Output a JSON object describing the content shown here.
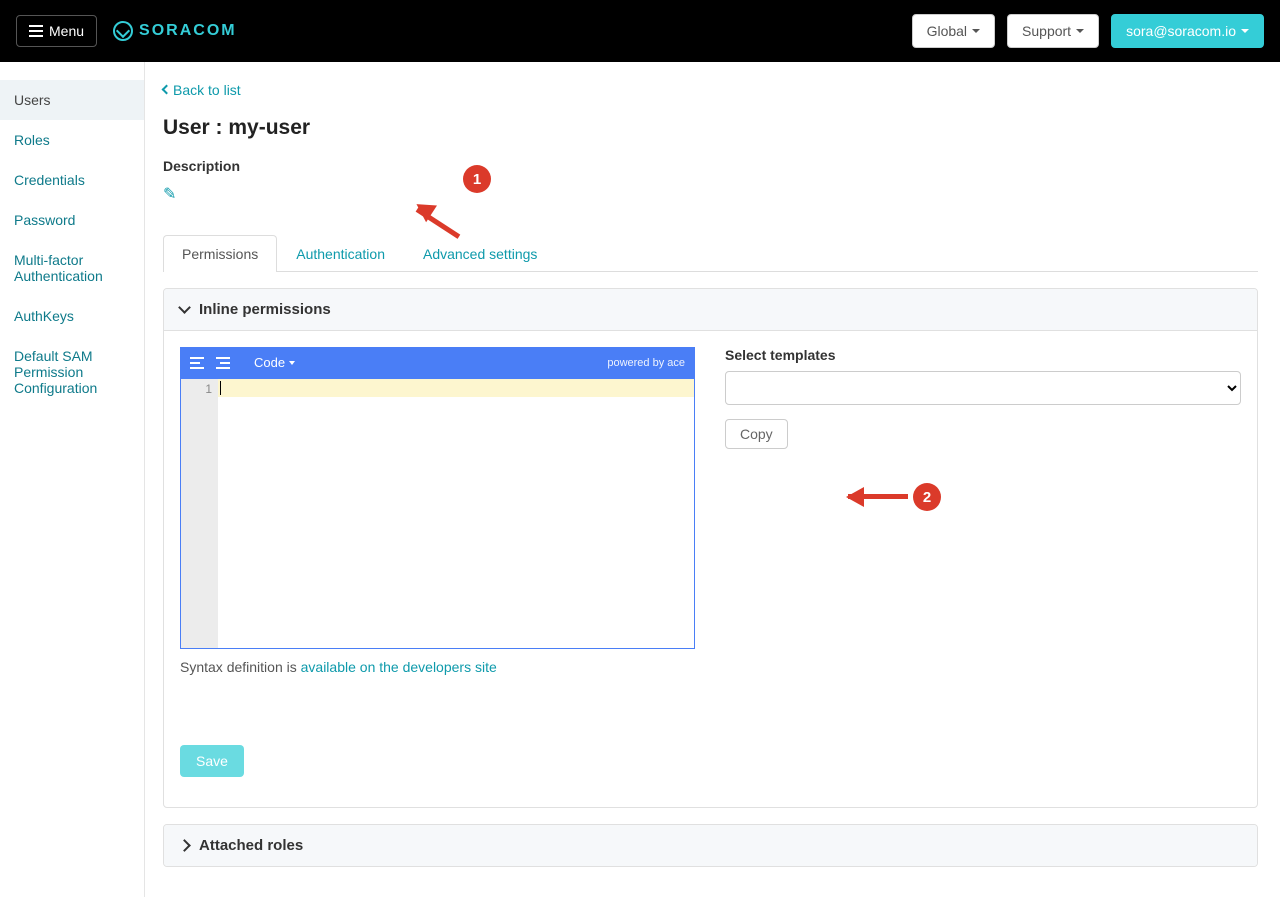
{
  "topbar": {
    "menu_label": "Menu",
    "brand": "SORACOM",
    "global": "Global",
    "support": "Support",
    "account": "sora@soracom.io"
  },
  "sidebar": {
    "items": [
      {
        "label": "Users",
        "active": true
      },
      {
        "label": "Roles"
      },
      {
        "label": "Credentials"
      },
      {
        "label": "Password"
      },
      {
        "label": "Multi-factor Authentication"
      },
      {
        "label": "AuthKeys"
      },
      {
        "label": "Default SAM Permission Configuration"
      }
    ]
  },
  "content": {
    "back_link": "Back to list",
    "title": "User : my-user",
    "description_label": "Description",
    "tabs": [
      {
        "label": "Permissions",
        "active": true
      },
      {
        "label": "Authentication"
      },
      {
        "label": "Advanced settings"
      }
    ],
    "inline_panel": {
      "title": "Inline permissions",
      "expanded": true,
      "editor": {
        "code_label": "Code",
        "powered_by": "powered by ace",
        "gutter_line": "1"
      },
      "syntax_note_prefix": "Syntax definition is ",
      "syntax_note_link": "available on the developers site",
      "save_label": "Save",
      "template_label": "Select templates",
      "copy_label": "Copy"
    },
    "roles_panel": {
      "title": "Attached roles",
      "expanded": false
    }
  },
  "annotations": {
    "badge1": "1",
    "badge2": "2"
  }
}
